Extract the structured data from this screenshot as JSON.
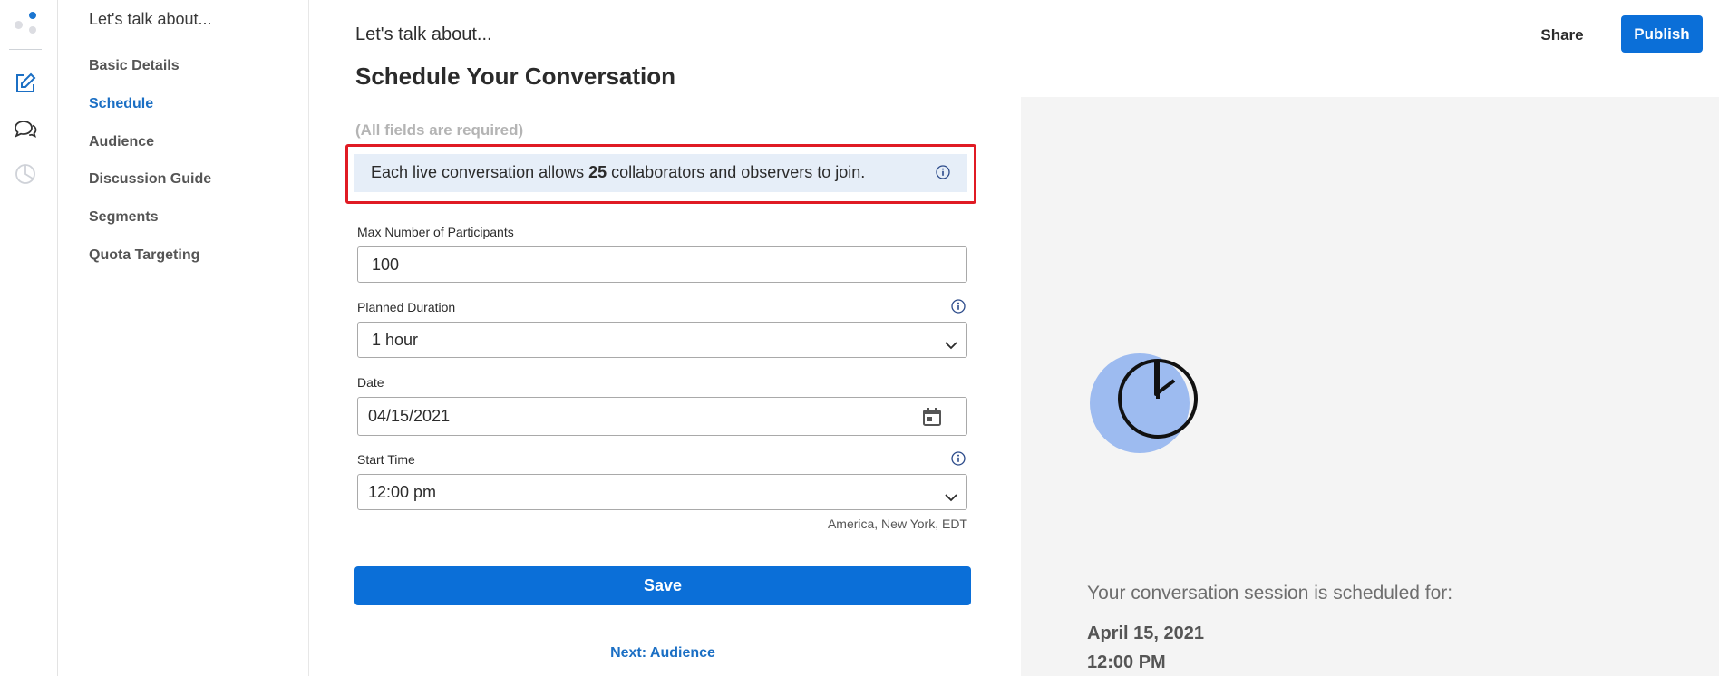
{
  "nav": {
    "title": "Let's talk about...",
    "items": [
      {
        "label": "Basic Details",
        "active": false
      },
      {
        "label": "Schedule",
        "active": true
      },
      {
        "label": "Audience",
        "active": false
      },
      {
        "label": "Discussion Guide",
        "active": false
      },
      {
        "label": "Segments",
        "active": false
      },
      {
        "label": "Quota Targeting",
        "active": false
      }
    ]
  },
  "header": {
    "kicker": "Let's talk about...",
    "title": "Schedule Your Conversation",
    "share_label": "Share",
    "publish_label": "Publish"
  },
  "form": {
    "required_note": "(All fields are required)",
    "info": {
      "prefix": "Each live conversation allows ",
      "count": "25",
      "suffix": " collaborators and observers to join."
    },
    "max_participants": {
      "label": "Max Number of Participants",
      "value": "100"
    },
    "planned_duration": {
      "label": "Planned Duration",
      "value": "1 hour"
    },
    "date": {
      "label": "Date",
      "value": "04/15/2021"
    },
    "start_time": {
      "label": "Start Time",
      "value": "12:00 pm"
    },
    "timezone_note": "America, New York, EDT",
    "save_label": "Save",
    "next_label": "Next: Audience"
  },
  "preview": {
    "caption": "Your conversation session is scheduled for:",
    "date": "April 15, 2021",
    "time": "12:00 PM"
  },
  "icons": {
    "rail": [
      "logo-icon",
      "edit-icon",
      "chat-icon",
      "pie-chart-icon"
    ],
    "info": "info-icon",
    "dropdown": "chevron-down-icon",
    "calendar": "calendar-icon",
    "clock": "clock-icon"
  },
  "colors": {
    "accent": "#0b6fd8",
    "active_nav": "#1b6fc4",
    "highlight_border": "#e01b24",
    "info_bg": "#e6eef8",
    "clock_circle": "#9dbbf0"
  }
}
